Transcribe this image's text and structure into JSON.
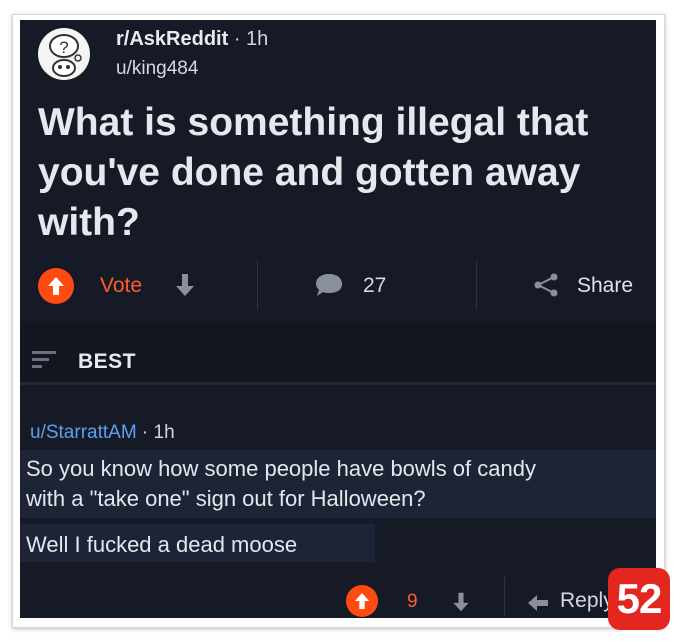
{
  "post": {
    "subreddit": "r/AskReddit",
    "time": "1h",
    "author": "u/king484",
    "title": "What is something illegal that you've done and gotten away with?"
  },
  "actions": {
    "vote_label": "Vote",
    "comment_count": "27",
    "share_label": "Share"
  },
  "sort": {
    "label": "BEST"
  },
  "comment": {
    "author": "u/StarrattAM",
    "time": "1h",
    "lines": [
      "So you know how some people have bowls of candy",
      "with a \"take one\" sign out for Halloween?",
      "Well I fucked a dead moose"
    ],
    "score": "9",
    "reply_label": "Reply"
  },
  "badge": {
    "number": "52"
  },
  "colors": {
    "background": "#161a27",
    "upvote": "#ff4a12",
    "username_link": "#5aa0ee",
    "badge": "#e3261f"
  },
  "icons": [
    "snoo-avatar-icon",
    "upvote-arrow-icon",
    "downvote-arrow-icon",
    "comment-bubble-icon",
    "share-icon",
    "sort-icon",
    "reply-arrow-icon"
  ]
}
